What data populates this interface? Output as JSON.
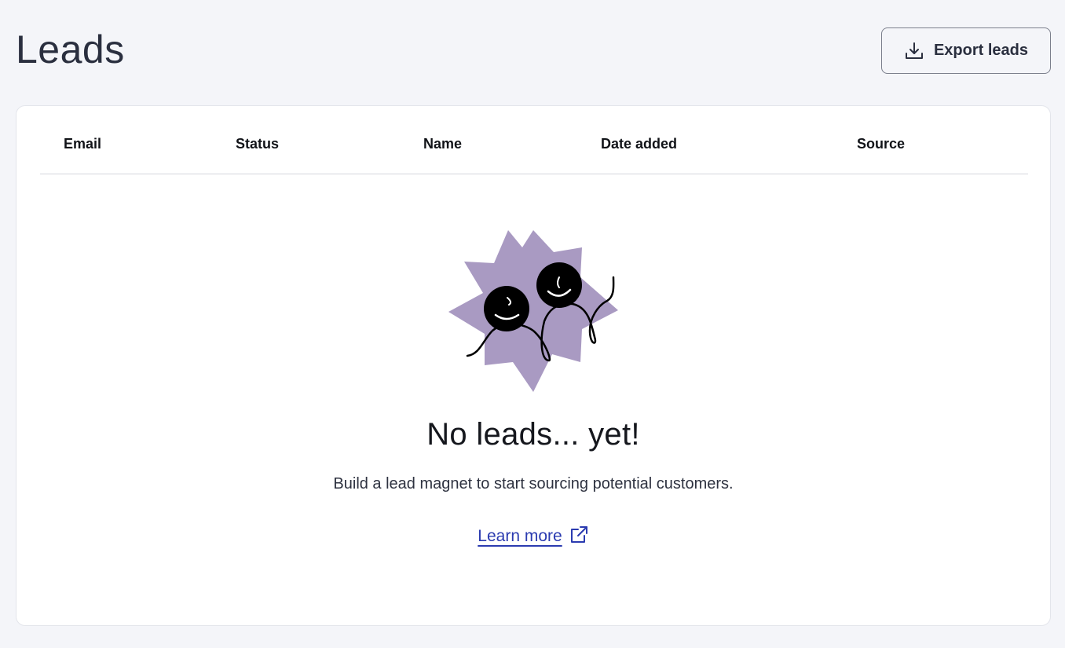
{
  "header": {
    "title": "Leads",
    "export_label": "Export leads",
    "export_icon": "download-icon"
  },
  "table": {
    "columns": [
      "Email",
      "Status",
      "Name",
      "Date added",
      "Source"
    ]
  },
  "empty_state": {
    "illustration": "two-smiling-faces-starburst",
    "title": "No leads... yet!",
    "description": "Build a lead magnet to start sourcing potential customers.",
    "link_label": "Learn more",
    "link_icon": "external-link-icon"
  },
  "colors": {
    "background": "#f4f5f9",
    "card": "#ffffff",
    "starburst": "#a99ac2",
    "link": "#2b3bb0"
  }
}
